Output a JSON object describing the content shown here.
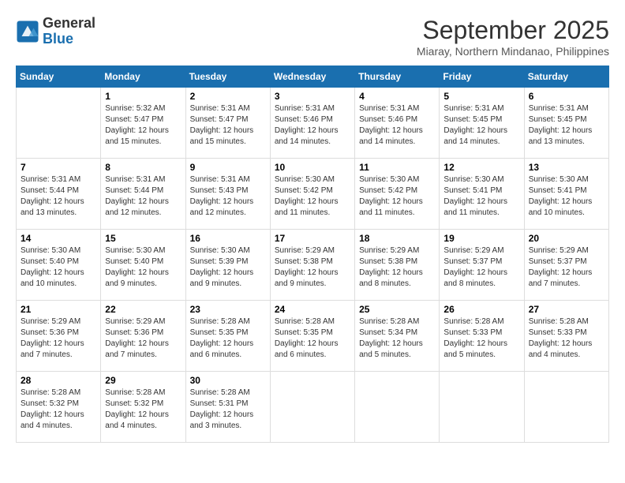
{
  "header": {
    "logo_line1": "General",
    "logo_line2": "Blue",
    "month": "September 2025",
    "location": "Miaray, Northern Mindanao, Philippines"
  },
  "weekdays": [
    "Sunday",
    "Monday",
    "Tuesday",
    "Wednesday",
    "Thursday",
    "Friday",
    "Saturday"
  ],
  "weeks": [
    [
      {
        "day": "",
        "info": ""
      },
      {
        "day": "1",
        "info": "Sunrise: 5:32 AM\nSunset: 5:47 PM\nDaylight: 12 hours\nand 15 minutes."
      },
      {
        "day": "2",
        "info": "Sunrise: 5:31 AM\nSunset: 5:47 PM\nDaylight: 12 hours\nand 15 minutes."
      },
      {
        "day": "3",
        "info": "Sunrise: 5:31 AM\nSunset: 5:46 PM\nDaylight: 12 hours\nand 14 minutes."
      },
      {
        "day": "4",
        "info": "Sunrise: 5:31 AM\nSunset: 5:46 PM\nDaylight: 12 hours\nand 14 minutes."
      },
      {
        "day": "5",
        "info": "Sunrise: 5:31 AM\nSunset: 5:45 PM\nDaylight: 12 hours\nand 14 minutes."
      },
      {
        "day": "6",
        "info": "Sunrise: 5:31 AM\nSunset: 5:45 PM\nDaylight: 12 hours\nand 13 minutes."
      }
    ],
    [
      {
        "day": "7",
        "info": "Sunrise: 5:31 AM\nSunset: 5:44 PM\nDaylight: 12 hours\nand 13 minutes."
      },
      {
        "day": "8",
        "info": "Sunrise: 5:31 AM\nSunset: 5:44 PM\nDaylight: 12 hours\nand 12 minutes."
      },
      {
        "day": "9",
        "info": "Sunrise: 5:31 AM\nSunset: 5:43 PM\nDaylight: 12 hours\nand 12 minutes."
      },
      {
        "day": "10",
        "info": "Sunrise: 5:30 AM\nSunset: 5:42 PM\nDaylight: 12 hours\nand 11 minutes."
      },
      {
        "day": "11",
        "info": "Sunrise: 5:30 AM\nSunset: 5:42 PM\nDaylight: 12 hours\nand 11 minutes."
      },
      {
        "day": "12",
        "info": "Sunrise: 5:30 AM\nSunset: 5:41 PM\nDaylight: 12 hours\nand 11 minutes."
      },
      {
        "day": "13",
        "info": "Sunrise: 5:30 AM\nSunset: 5:41 PM\nDaylight: 12 hours\nand 10 minutes."
      }
    ],
    [
      {
        "day": "14",
        "info": "Sunrise: 5:30 AM\nSunset: 5:40 PM\nDaylight: 12 hours\nand 10 minutes."
      },
      {
        "day": "15",
        "info": "Sunrise: 5:30 AM\nSunset: 5:40 PM\nDaylight: 12 hours\nand 9 minutes."
      },
      {
        "day": "16",
        "info": "Sunrise: 5:30 AM\nSunset: 5:39 PM\nDaylight: 12 hours\nand 9 minutes."
      },
      {
        "day": "17",
        "info": "Sunrise: 5:29 AM\nSunset: 5:38 PM\nDaylight: 12 hours\nand 9 minutes."
      },
      {
        "day": "18",
        "info": "Sunrise: 5:29 AM\nSunset: 5:38 PM\nDaylight: 12 hours\nand 8 minutes."
      },
      {
        "day": "19",
        "info": "Sunrise: 5:29 AM\nSunset: 5:37 PM\nDaylight: 12 hours\nand 8 minutes."
      },
      {
        "day": "20",
        "info": "Sunrise: 5:29 AM\nSunset: 5:37 PM\nDaylight: 12 hours\nand 7 minutes."
      }
    ],
    [
      {
        "day": "21",
        "info": "Sunrise: 5:29 AM\nSunset: 5:36 PM\nDaylight: 12 hours\nand 7 minutes."
      },
      {
        "day": "22",
        "info": "Sunrise: 5:29 AM\nSunset: 5:36 PM\nDaylight: 12 hours\nand 7 minutes."
      },
      {
        "day": "23",
        "info": "Sunrise: 5:28 AM\nSunset: 5:35 PM\nDaylight: 12 hours\nand 6 minutes."
      },
      {
        "day": "24",
        "info": "Sunrise: 5:28 AM\nSunset: 5:35 PM\nDaylight: 12 hours\nand 6 minutes."
      },
      {
        "day": "25",
        "info": "Sunrise: 5:28 AM\nSunset: 5:34 PM\nDaylight: 12 hours\nand 5 minutes."
      },
      {
        "day": "26",
        "info": "Sunrise: 5:28 AM\nSunset: 5:33 PM\nDaylight: 12 hours\nand 5 minutes."
      },
      {
        "day": "27",
        "info": "Sunrise: 5:28 AM\nSunset: 5:33 PM\nDaylight: 12 hours\nand 4 minutes."
      }
    ],
    [
      {
        "day": "28",
        "info": "Sunrise: 5:28 AM\nSunset: 5:32 PM\nDaylight: 12 hours\nand 4 minutes."
      },
      {
        "day": "29",
        "info": "Sunrise: 5:28 AM\nSunset: 5:32 PM\nDaylight: 12 hours\nand 4 minutes."
      },
      {
        "day": "30",
        "info": "Sunrise: 5:28 AM\nSunset: 5:31 PM\nDaylight: 12 hours\nand 3 minutes."
      },
      {
        "day": "",
        "info": ""
      },
      {
        "day": "",
        "info": ""
      },
      {
        "day": "",
        "info": ""
      },
      {
        "day": "",
        "info": ""
      }
    ]
  ]
}
